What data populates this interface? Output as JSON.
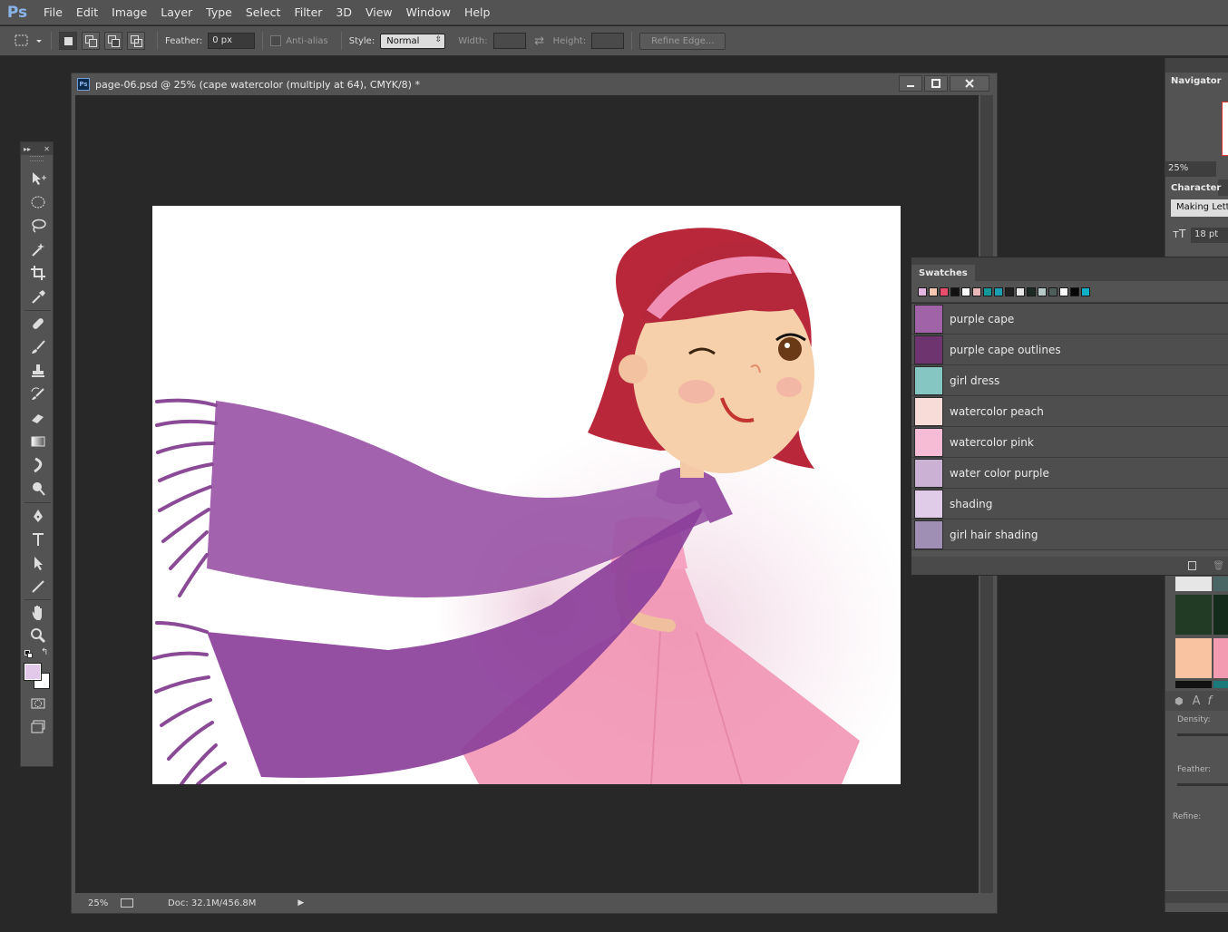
{
  "app": {
    "logo": "Ps"
  },
  "menu": [
    "File",
    "Edit",
    "Image",
    "Layer",
    "Type",
    "Select",
    "Filter",
    "3D",
    "View",
    "Window",
    "Help"
  ],
  "options": {
    "feather_label": "Feather:",
    "feather_value": "0 px",
    "antialias_label": "Anti-alias",
    "style_label": "Style:",
    "style_value": "Normal",
    "width_label": "Width:",
    "height_label": "Height:",
    "refine_edge": "Refine Edge..."
  },
  "document": {
    "title": "page-06.psd @ 25% (cape watercolor (multiply at 64), CMYK/8) *",
    "zoom": "25%",
    "doc_info": "Doc: 32.1M/456.8M"
  },
  "navigator": {
    "tab": "Navigator",
    "zoom": "25%"
  },
  "character": {
    "tab": "Character",
    "font": "Making Lette",
    "size": "18 pt"
  },
  "swatches": {
    "tab": "Swatches",
    "strip": [
      "#e3b7e0",
      "#f4c7b0",
      "#ea4c6c",
      "#111111",
      "#ffffff",
      "#e9b8b8",
      "#15989a",
      "#1c9fb3",
      "#1f1f1f",
      "#e8e8e8",
      "#1d2a24",
      "#b7c9c6",
      "#4f5e5b",
      "#ffffff",
      "#050505",
      "#11b0c5"
    ],
    "items": [
      {
        "name": "purple cape",
        "color": "#a163a8"
      },
      {
        "name": "purple cape outlines",
        "color": "#6e3470"
      },
      {
        "name": "girl dress",
        "color": "#85c5c2"
      },
      {
        "name": "watercolor peach",
        "color": "#f7dcd8"
      },
      {
        "name": "watercolor pink",
        "color": "#f6bcd5"
      },
      {
        "name": "water color purple",
        "color": "#cbb1d3"
      },
      {
        "name": "shading",
        "color": "#e0cbe8"
      },
      {
        "name": "girl hair shading",
        "color": "#9f8fb4"
      }
    ]
  },
  "properties": {
    "density_label": "Density:",
    "feather_label": "Feather:",
    "refine_label": "Refine:"
  },
  "colors": {
    "foreground": "#e3c9e9",
    "background": "#ffffff"
  }
}
